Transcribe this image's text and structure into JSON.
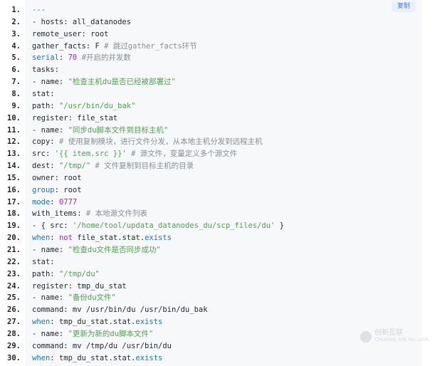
{
  "copy_label": "复制",
  "watermark": {
    "text": "创新互联",
    "sub": "CHUANG XIN HU LIAN"
  },
  "lines": [
    {
      "n": "1.",
      "tokens": [
        {
          "t": "---",
          "c": "t-kw"
        }
      ]
    },
    {
      "n": "2.",
      "tokens": [
        {
          "t": "- hosts: all_datanodes",
          "c": "t-default"
        }
      ]
    },
    {
      "n": "3.",
      "tokens": [
        {
          "t": "remote_user: root",
          "c": "t-default"
        }
      ]
    },
    {
      "n": "4.",
      "tokens": [
        {
          "t": "gather_facts: F ",
          "c": "t-default"
        },
        {
          "t": "# 跳过gather_facts环节",
          "c": "t-comment"
        }
      ]
    },
    {
      "n": "5.",
      "tokens": [
        {
          "t": "serial",
          "c": "t-kw"
        },
        {
          "t": ": ",
          "c": "t-default"
        },
        {
          "t": "70",
          "c": "t-num"
        },
        {
          "t": " ",
          "c": "t-default"
        },
        {
          "t": "#开启的并发数",
          "c": "t-comment"
        }
      ]
    },
    {
      "n": "6.",
      "tokens": [
        {
          "t": "tasks:",
          "c": "t-default"
        }
      ]
    },
    {
      "n": "7.",
      "tokens": [
        {
          "t": "- name: ",
          "c": "t-default"
        },
        {
          "t": "\"检查主机du是否已经被部署过\"",
          "c": "t-str"
        }
      ]
    },
    {
      "n": "8.",
      "tokens": [
        {
          "t": "stat:",
          "c": "t-default"
        }
      ]
    },
    {
      "n": "9.",
      "tokens": [
        {
          "t": "path: ",
          "c": "t-default"
        },
        {
          "t": "\"/usr/bin/du_bak\"",
          "c": "t-str"
        }
      ]
    },
    {
      "n": "10.",
      "tokens": [
        {
          "t": "register: file_stat",
          "c": "t-default"
        }
      ]
    },
    {
      "n": "11.",
      "tokens": [
        {
          "t": "- name: ",
          "c": "t-default"
        },
        {
          "t": "\"同步du脚本文件到目标主机\"",
          "c": "t-str"
        }
      ]
    },
    {
      "n": "12.",
      "tokens": [
        {
          "t": "copy: ",
          "c": "t-default"
        },
        {
          "t": "# 使用复制模块，进行文件分发，从本地主机分发到远程主机",
          "c": "t-comment"
        }
      ]
    },
    {
      "n": "13.",
      "tokens": [
        {
          "t": "src: ",
          "c": "t-default"
        },
        {
          "t": "'{{ item.src }}'",
          "c": "t-str"
        },
        {
          "t": " ",
          "c": "t-default"
        },
        {
          "t": "# 源文件，变量定义多个源文件",
          "c": "t-comment"
        }
      ]
    },
    {
      "n": "14.",
      "tokens": [
        {
          "t": "dest: ",
          "c": "t-default"
        },
        {
          "t": "\"/tmp/\"",
          "c": "t-str"
        },
        {
          "t": " ",
          "c": "t-default"
        },
        {
          "t": "# 文件复制到目标主机的目录",
          "c": "t-comment"
        }
      ]
    },
    {
      "n": "15.",
      "tokens": [
        {
          "t": "owner: root",
          "c": "t-default"
        }
      ]
    },
    {
      "n": "16.",
      "tokens": [
        {
          "t": "group",
          "c": "t-kw"
        },
        {
          "t": ": root",
          "c": "t-default"
        }
      ]
    },
    {
      "n": "17.",
      "tokens": [
        {
          "t": "mode",
          "c": "t-kw"
        },
        {
          "t": ": ",
          "c": "t-default"
        },
        {
          "t": "0777",
          "c": "t-num"
        }
      ]
    },
    {
      "n": "18.",
      "tokens": [
        {
          "t": "with_items: ",
          "c": "t-default"
        },
        {
          "t": "# 本地源文件列表",
          "c": "t-comment"
        }
      ]
    },
    {
      "n": "19.",
      "tokens": [
        {
          "t": "- { src: ",
          "c": "t-default"
        },
        {
          "t": "'/home/tool/updata_datanodes_du/scp_files/du'",
          "c": "t-str"
        },
        {
          "t": " }",
          "c": "t-default"
        }
      ]
    },
    {
      "n": "20.",
      "tokens": [
        {
          "t": "when",
          "c": "t-kw"
        },
        {
          "t": ": ",
          "c": "t-default"
        },
        {
          "t": "not",
          "c": "t-neg"
        },
        {
          "t": " file_stat.stat.",
          "c": "t-default"
        },
        {
          "t": "exists",
          "c": "t-attr"
        }
      ]
    },
    {
      "n": "21.",
      "tokens": [
        {
          "t": "- name: ",
          "c": "t-default"
        },
        {
          "t": "\"检查du文件是否同步成功\"",
          "c": "t-str"
        }
      ]
    },
    {
      "n": "22.",
      "tokens": [
        {
          "t": "stat:",
          "c": "t-default"
        }
      ]
    },
    {
      "n": "23.",
      "tokens": [
        {
          "t": "path: ",
          "c": "t-default"
        },
        {
          "t": "\"/tmp/du\"",
          "c": "t-str"
        }
      ]
    },
    {
      "n": "24.",
      "tokens": [
        {
          "t": "register: tmp_du_stat",
          "c": "t-default"
        }
      ]
    },
    {
      "n": "25.",
      "tokens": [
        {
          "t": "- name: ",
          "c": "t-default"
        },
        {
          "t": "\"备份du文件\"",
          "c": "t-str"
        }
      ]
    },
    {
      "n": "26.",
      "tokens": [
        {
          "t": "command: mv /usr/bin/du /usr/bin/du_bak",
          "c": "t-default"
        }
      ]
    },
    {
      "n": "27.",
      "tokens": [
        {
          "t": "when",
          "c": "t-kw"
        },
        {
          "t": ": tmp_du_stat.stat.",
          "c": "t-default"
        },
        {
          "t": "exists",
          "c": "t-attr"
        }
      ]
    },
    {
      "n": "28.",
      "tokens": [
        {
          "t": "- name: ",
          "c": "t-default"
        },
        {
          "t": "\"更新为新的du脚本文件\"",
          "c": "t-str"
        }
      ]
    },
    {
      "n": "29.",
      "tokens": [
        {
          "t": "command: mv /tmp/du /usr/bin/du",
          "c": "t-default"
        }
      ]
    },
    {
      "n": "30.",
      "tokens": [
        {
          "t": "when",
          "c": "t-kw"
        },
        {
          "t": ": tmp_du_stat.stat.",
          "c": "t-default"
        },
        {
          "t": "exists",
          "c": "t-attr"
        }
      ]
    }
  ]
}
